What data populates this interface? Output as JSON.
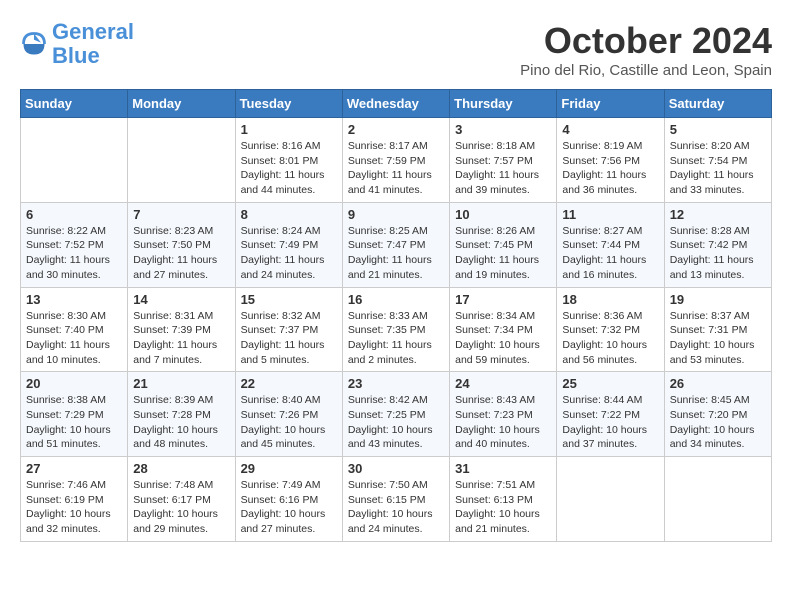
{
  "header": {
    "logo_line1": "General",
    "logo_line2": "Blue",
    "month_title": "October 2024",
    "location": "Pino del Rio, Castille and Leon, Spain"
  },
  "days_of_week": [
    "Sunday",
    "Monday",
    "Tuesday",
    "Wednesday",
    "Thursday",
    "Friday",
    "Saturday"
  ],
  "weeks": [
    [
      {
        "day": "",
        "info": ""
      },
      {
        "day": "",
        "info": ""
      },
      {
        "day": "1",
        "info": "Sunrise: 8:16 AM\nSunset: 8:01 PM\nDaylight: 11 hours and 44 minutes."
      },
      {
        "day": "2",
        "info": "Sunrise: 8:17 AM\nSunset: 7:59 PM\nDaylight: 11 hours and 41 minutes."
      },
      {
        "day": "3",
        "info": "Sunrise: 8:18 AM\nSunset: 7:57 PM\nDaylight: 11 hours and 39 minutes."
      },
      {
        "day": "4",
        "info": "Sunrise: 8:19 AM\nSunset: 7:56 PM\nDaylight: 11 hours and 36 minutes."
      },
      {
        "day": "5",
        "info": "Sunrise: 8:20 AM\nSunset: 7:54 PM\nDaylight: 11 hours and 33 minutes."
      }
    ],
    [
      {
        "day": "6",
        "info": "Sunrise: 8:22 AM\nSunset: 7:52 PM\nDaylight: 11 hours and 30 minutes."
      },
      {
        "day": "7",
        "info": "Sunrise: 8:23 AM\nSunset: 7:50 PM\nDaylight: 11 hours and 27 minutes."
      },
      {
        "day": "8",
        "info": "Sunrise: 8:24 AM\nSunset: 7:49 PM\nDaylight: 11 hours and 24 minutes."
      },
      {
        "day": "9",
        "info": "Sunrise: 8:25 AM\nSunset: 7:47 PM\nDaylight: 11 hours and 21 minutes."
      },
      {
        "day": "10",
        "info": "Sunrise: 8:26 AM\nSunset: 7:45 PM\nDaylight: 11 hours and 19 minutes."
      },
      {
        "day": "11",
        "info": "Sunrise: 8:27 AM\nSunset: 7:44 PM\nDaylight: 11 hours and 16 minutes."
      },
      {
        "day": "12",
        "info": "Sunrise: 8:28 AM\nSunset: 7:42 PM\nDaylight: 11 hours and 13 minutes."
      }
    ],
    [
      {
        "day": "13",
        "info": "Sunrise: 8:30 AM\nSunset: 7:40 PM\nDaylight: 11 hours and 10 minutes."
      },
      {
        "day": "14",
        "info": "Sunrise: 8:31 AM\nSunset: 7:39 PM\nDaylight: 11 hours and 7 minutes."
      },
      {
        "day": "15",
        "info": "Sunrise: 8:32 AM\nSunset: 7:37 PM\nDaylight: 11 hours and 5 minutes."
      },
      {
        "day": "16",
        "info": "Sunrise: 8:33 AM\nSunset: 7:35 PM\nDaylight: 11 hours and 2 minutes."
      },
      {
        "day": "17",
        "info": "Sunrise: 8:34 AM\nSunset: 7:34 PM\nDaylight: 10 hours and 59 minutes."
      },
      {
        "day": "18",
        "info": "Sunrise: 8:36 AM\nSunset: 7:32 PM\nDaylight: 10 hours and 56 minutes."
      },
      {
        "day": "19",
        "info": "Sunrise: 8:37 AM\nSunset: 7:31 PM\nDaylight: 10 hours and 53 minutes."
      }
    ],
    [
      {
        "day": "20",
        "info": "Sunrise: 8:38 AM\nSunset: 7:29 PM\nDaylight: 10 hours and 51 minutes."
      },
      {
        "day": "21",
        "info": "Sunrise: 8:39 AM\nSunset: 7:28 PM\nDaylight: 10 hours and 48 minutes."
      },
      {
        "day": "22",
        "info": "Sunrise: 8:40 AM\nSunset: 7:26 PM\nDaylight: 10 hours and 45 minutes."
      },
      {
        "day": "23",
        "info": "Sunrise: 8:42 AM\nSunset: 7:25 PM\nDaylight: 10 hours and 43 minutes."
      },
      {
        "day": "24",
        "info": "Sunrise: 8:43 AM\nSunset: 7:23 PM\nDaylight: 10 hours and 40 minutes."
      },
      {
        "day": "25",
        "info": "Sunrise: 8:44 AM\nSunset: 7:22 PM\nDaylight: 10 hours and 37 minutes."
      },
      {
        "day": "26",
        "info": "Sunrise: 8:45 AM\nSunset: 7:20 PM\nDaylight: 10 hours and 34 minutes."
      }
    ],
    [
      {
        "day": "27",
        "info": "Sunrise: 7:46 AM\nSunset: 6:19 PM\nDaylight: 10 hours and 32 minutes."
      },
      {
        "day": "28",
        "info": "Sunrise: 7:48 AM\nSunset: 6:17 PM\nDaylight: 10 hours and 29 minutes."
      },
      {
        "day": "29",
        "info": "Sunrise: 7:49 AM\nSunset: 6:16 PM\nDaylight: 10 hours and 27 minutes."
      },
      {
        "day": "30",
        "info": "Sunrise: 7:50 AM\nSunset: 6:15 PM\nDaylight: 10 hours and 24 minutes."
      },
      {
        "day": "31",
        "info": "Sunrise: 7:51 AM\nSunset: 6:13 PM\nDaylight: 10 hours and 21 minutes."
      },
      {
        "day": "",
        "info": ""
      },
      {
        "day": "",
        "info": ""
      }
    ]
  ]
}
